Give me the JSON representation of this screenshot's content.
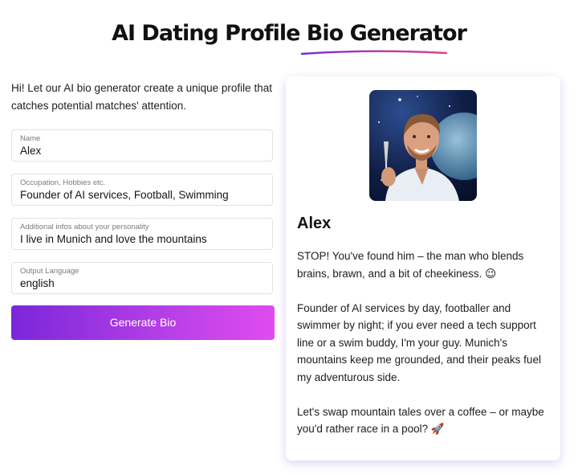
{
  "page": {
    "title": "AI Dating Profile Bio Generator",
    "intro": "Hi! Let our AI bio generator create a unique profile that catches potential matches' attention."
  },
  "form": {
    "name": {
      "label": "Name",
      "value": "Alex"
    },
    "occupation": {
      "label": "Occupation, Hobbies etc.",
      "value": "Founder of AI services, Football, Swimming"
    },
    "personality": {
      "label": "Additional infos about your personality",
      "value": "I live in Munich and love the mountains"
    },
    "language": {
      "label": "Output Language",
      "value": "english"
    },
    "generate_label": "Generate Bio"
  },
  "result": {
    "name": "Alex",
    "bio": [
      "STOP! You've found him – the man who blends brains, brawn, and a bit of cheekiness. 😉",
      "Founder of AI services by day, footballer and swimmer by night; if you ever need a tech support line or a swim buddy, I'm your guy. Munich's mountains keep me grounded, and their peaks fuel my adventurous side.",
      "Let's swap mountain tales over a coffee – or maybe you'd rather race in a pool? 🚀"
    ]
  },
  "colors": {
    "accent_start": "#7a27d9",
    "accent_end": "#e04bef",
    "underline": "#a43ee0"
  }
}
